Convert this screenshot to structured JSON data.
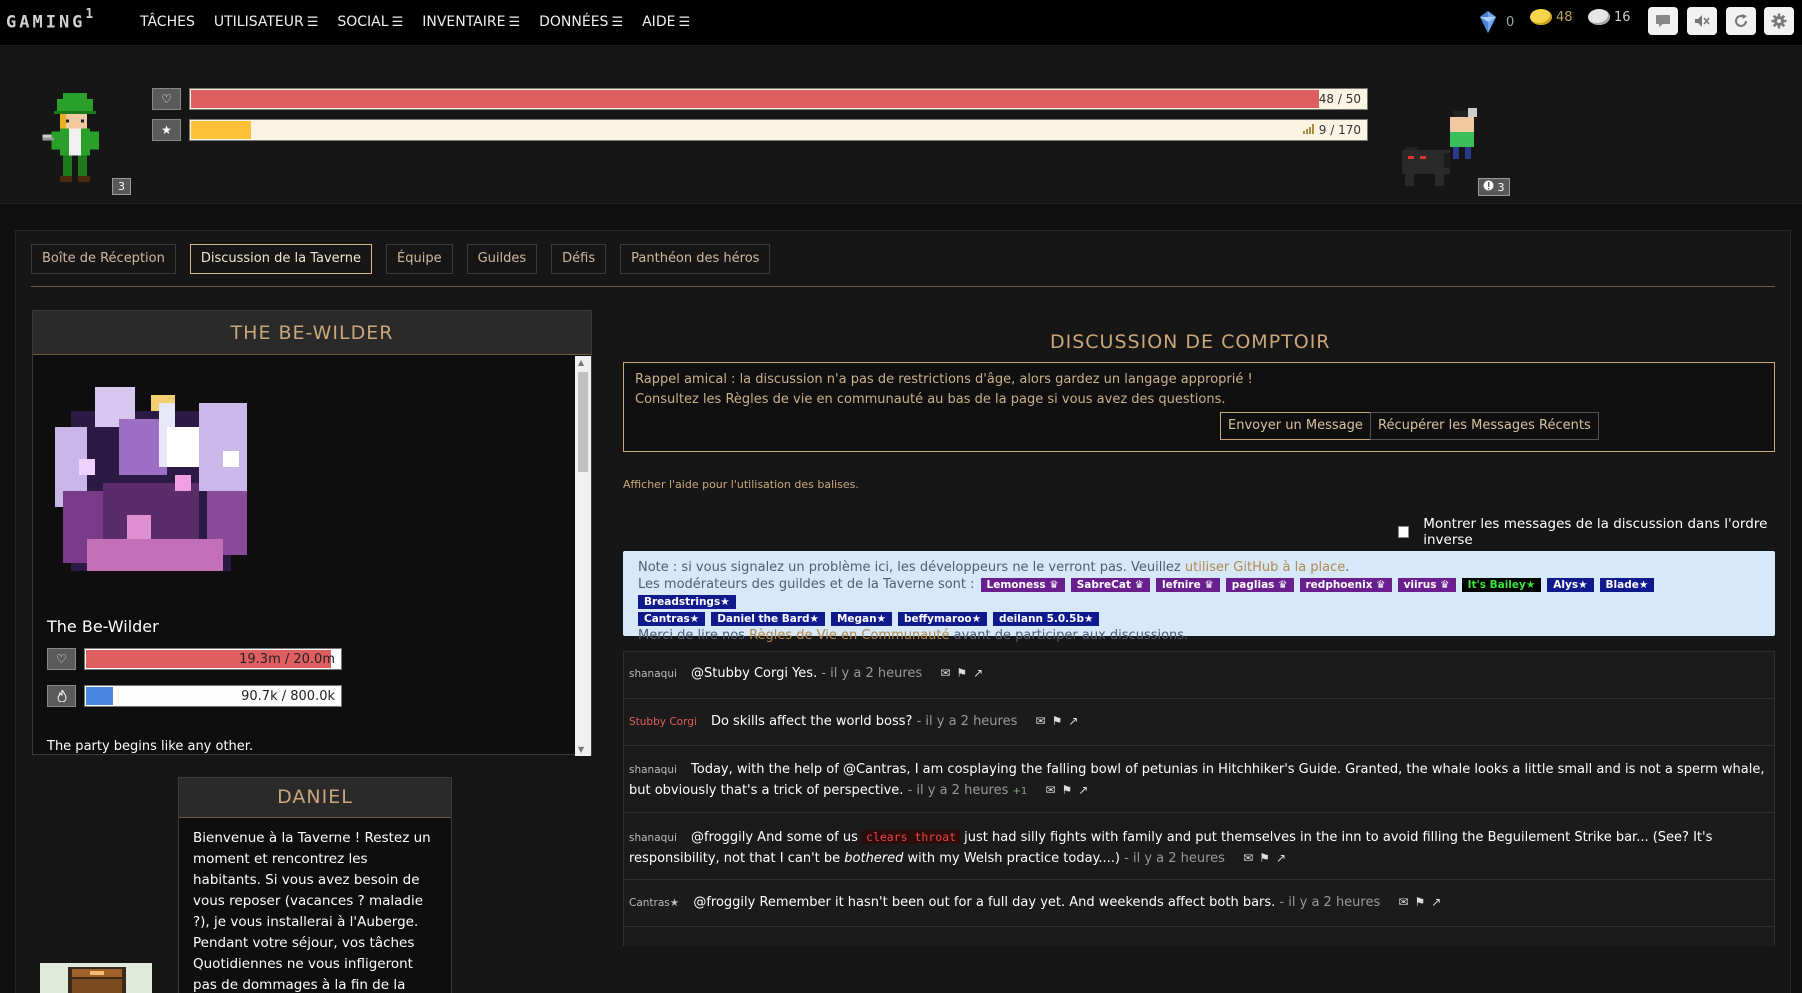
{
  "app": {
    "logo_text": "GAMING",
    "logo_sup": "1"
  },
  "nav": {
    "items": [
      {
        "label": "TÂCHES",
        "has_menu": false
      },
      {
        "label": "UTILISATEUR",
        "has_menu": true
      },
      {
        "label": "SOCIAL",
        "has_menu": true
      },
      {
        "label": "INVENTAIRE",
        "has_menu": true
      },
      {
        "label": "DONNÉES",
        "has_menu": true
      },
      {
        "label": "AIDE",
        "has_menu": true
      }
    ],
    "menu_glyph": "☰",
    "gems": "0",
    "gold": "48",
    "silver": "16",
    "icon_buttons": [
      "chat-icon",
      "mute-icon",
      "sync-icon",
      "settings-icon"
    ]
  },
  "header": {
    "level": "3",
    "health_text": "48 / 50",
    "health_fraction": 0.96,
    "exp_text": "9 / 170",
    "exp_fraction": 0.053,
    "party_count": "3",
    "colors": {
      "health": "#df5f61",
      "exp": "#ffc03a"
    }
  },
  "tabs": [
    {
      "label": "Boîte de Réception",
      "active": false
    },
    {
      "label": "Discussion de la Taverne",
      "active": true
    },
    {
      "label": "Équipe",
      "active": false
    },
    {
      "label": "Guildes",
      "active": false
    },
    {
      "label": "Défis",
      "active": false
    },
    {
      "label": "Panthéon des héros",
      "active": false
    }
  ],
  "boss": {
    "header": "THE BE-WILDER",
    "name": "The Be-Wilder",
    "hp_text": "19.3m  / 20.0m",
    "hp_fraction": 0.965,
    "rage_text": "90.7k / 800.0k",
    "rage_fraction": 0.113,
    "description": "The party begins like any other.",
    "colors": {
      "hp": "#df5f61",
      "rage": "#4b86e0"
    }
  },
  "daniel": {
    "title": "DANIEL",
    "text": "Bienvenue à la Taverne ! Restez un moment et rencontrez les habitants. Si vous avez besoin de vous reposer (vacances ? maladie ?), je vous installerai à l'Auberge. Pendant votre séjour, vos tâches Quotidiennes ne vous infligeront pas de dommages à la fin de la journée, mais vous pourrez quand même les"
  },
  "chat": {
    "title": "DISCUSSION DE COMPTOIR",
    "placeholder_line1": "Rappel amical : la discussion n'a pas de restrictions d'âge, alors gardez un langage approprié !",
    "placeholder_line2": "Consultez les Règles de vie en communauté au bas de la page si vous avez des questions.",
    "markup_help": "Afficher l'aide pour l'utilisation des balises.",
    "send_button": "Envoyer un Message",
    "fetch_button": "Récupérer les Messages Récents",
    "reverse_label": "Montrer les messages de la discussion dans l'ordre inverse",
    "note": {
      "line1_prefix": "Note : si vous signalez un problème ici, les développeurs ne le verront pas. Veuillez ",
      "line1_link": "utiliser GitHub à la place",
      "line1_suffix": ".",
      "mods_label": "Les modérateurs des guildes et de la Taverne sont :",
      "mods": [
        {
          "name": "Lemoness ♛",
          "color": "#6b1f8e"
        },
        {
          "name": "SabreCat ♛",
          "color": "#6b1f8e"
        },
        {
          "name": "lefnire ♛",
          "color": "#6b1f8e"
        },
        {
          "name": "paglias ♛",
          "color": "#6b1f8e"
        },
        {
          "name": "redphoenix ♛",
          "color": "#6b1f8e"
        },
        {
          "name": "viirus ♛",
          "color": "#6b1f8e"
        },
        {
          "name": "It's Bailey★",
          "color": "#000000",
          "text_color": "#39e639"
        },
        {
          "name": "Alys★",
          "color": "#101a8c"
        },
        {
          "name": "Blade★",
          "color": "#101a8c"
        },
        {
          "name": "Breadstrings★",
          "color": "#101a8c"
        },
        {
          "name": "Cantras★",
          "color": "#101a8c"
        },
        {
          "name": "Daniel the Bard★",
          "color": "#101a8c"
        },
        {
          "name": "Megan★",
          "color": "#101a8c"
        },
        {
          "name": "beffymaroo★",
          "color": "#101a8c"
        },
        {
          "name": "deilann 5.0.5b★",
          "color": "#101a8c"
        }
      ],
      "line3_prefix": "Merci de lire nos ",
      "line3_link": "Règles de Vie en Communauté",
      "line3_suffix": " avant de participer aux discussions."
    },
    "messages": [
      {
        "user": "shanaqui",
        "user_color": "#bbbbbb",
        "text": "@Stubby Corgi Yes.",
        "time": "- il y a 2 heures",
        "height": 47
      },
      {
        "user": "Stubby Corgi",
        "user_color": "#e06060",
        "text": "Do skills affect the world boss?",
        "time": "- il y a 2 heures",
        "height": 47
      },
      {
        "user": "shanaqui",
        "user_color": "#bbbbbb",
        "text": "Today, with the help of @Cantras, I am cosplaying the falling bowl of petunias in Hitchhiker's Guide. Granted, the whale looks a little small and is not a sperm whale, but obviously that's a trick of perspective.",
        "time": "- il y a 2 heures",
        "plus": "+1",
        "height": 67
      },
      {
        "user": "shanaqui",
        "user_color": "#bbbbbb",
        "text_a": "@froggily And some of us ",
        "code": "clears throat",
        "text_b": " just had silly fights with family and put themselves in the inn to avoid filling the Beguilement Strike bar... (See? It's responsibility, not that I can't be ",
        "em": "bothered",
        "text_c": " with my Welsh practice today....)",
        "time": "- il y a 2 heures",
        "height": 67
      },
      {
        "user": "Cantras★",
        "user_color": "#cccccc",
        "text": "@froggily Remember it hasn't been out for a full day yet. And weekends affect both bars.",
        "time": "- il y a 2 heures",
        "height": 47
      }
    ]
  }
}
